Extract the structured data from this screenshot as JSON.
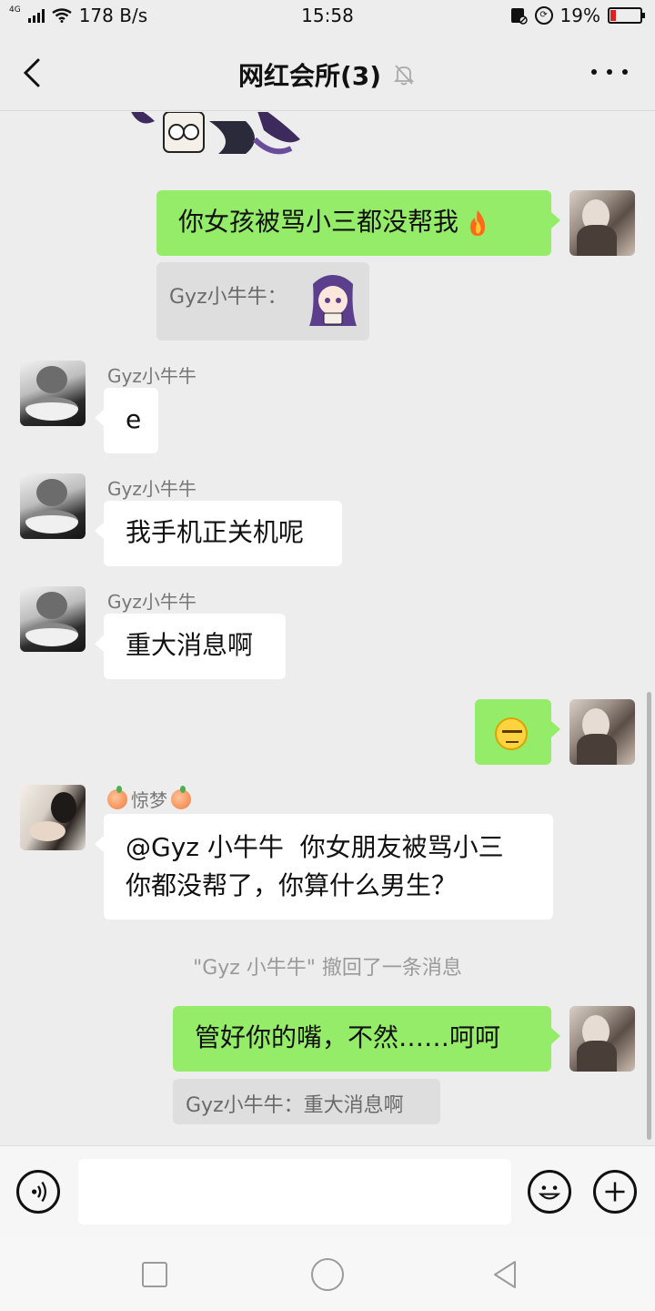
{
  "status_bar": {
    "network": "4G",
    "speed": "178 B/s",
    "time": "15:58",
    "battery": "19%",
    "battery_level": 0.19
  },
  "header": {
    "title": "网红会所(3)",
    "back_icon": "chevron-left-icon",
    "mute_icon": "bell-muted-icon",
    "more_icon": "more-dots-icon"
  },
  "messages": [
    {
      "side": "right",
      "text": "你女孩被骂小三都没帮我",
      "emoji": "fire-icon",
      "quote": "Gyz小牛牛："
    },
    {
      "side": "left",
      "sender": "Gyz小牛牛",
      "text": "e"
    },
    {
      "side": "left",
      "sender": "Gyz小牛牛",
      "text": "我手机正关机呢"
    },
    {
      "side": "left",
      "sender": "Gyz小牛牛",
      "text": "重大消息啊"
    },
    {
      "side": "right",
      "emoji": "unamused-face-icon"
    },
    {
      "side": "left",
      "sender": "惊梦",
      "text_line1": "@Gyz 小牛牛  你女朋友被骂小三",
      "text_line2": "你都没帮了，你算什么男生？"
    },
    {
      "system": "\"Gyz 小牛牛\" 撤回了一条消息"
    },
    {
      "side": "right",
      "text": "管好你的嘴，不然……呵呵",
      "quote": "Gyz小牛牛：重大消息啊"
    }
  ],
  "input_bar": {
    "voice_icon": "voice-icon",
    "emoji_icon": "emoji-icon",
    "plus_icon": "plus-icon"
  },
  "nav_bar": {
    "recent_icon": "square-icon",
    "home_icon": "circle-icon",
    "back_icon": "triangle-back-icon"
  },
  "colors": {
    "background": "#ededed",
    "green_bubble": "#95ec69",
    "white_bubble": "#ffffff",
    "quote_bg": "#dedede"
  }
}
